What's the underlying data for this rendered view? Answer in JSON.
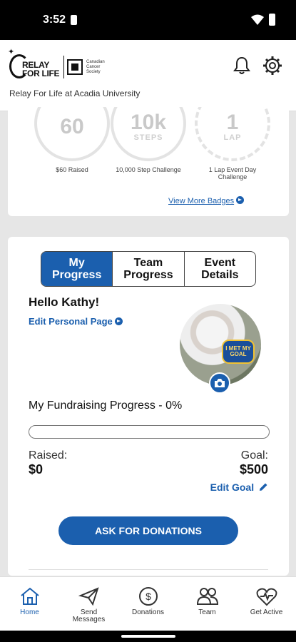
{
  "status_bar": {
    "time": "3:52"
  },
  "header": {
    "logo_text_top": "RELAY",
    "logo_text_bottom": "FOR LIFE",
    "partner_text": "Canadian Cancer Society",
    "subtitle": "Relay For Life at Acadia University"
  },
  "badges": {
    "items": [
      {
        "value": "60",
        "unit": "",
        "label": "$60 Raised"
      },
      {
        "value": "10k",
        "unit": "STEPS",
        "label": "10,000 Step Challenge"
      },
      {
        "value": "1",
        "unit": "LAP",
        "label": "1 Lap Event Day Challenge"
      }
    ],
    "view_more": "View More Badges"
  },
  "progress": {
    "tabs": [
      {
        "label": "My\nProgress",
        "active": true
      },
      {
        "label": "Team\nProgress",
        "active": false
      },
      {
        "label": "Event\nDetails",
        "active": false
      }
    ],
    "greeting": "Hello Kathy!",
    "edit_personal_page": "Edit Personal Page",
    "goal_badge_text": "I MET MY GOAL",
    "fundraising_title": "My Fundraising Progress - 0%",
    "percent": 0,
    "raised_label": "Raised:",
    "raised_value": "$0",
    "goal_label": "Goal:",
    "goal_value": "$500",
    "edit_goal": "Edit Goal",
    "ask_button": "ASK FOR DONATIONS"
  },
  "nav": {
    "items": [
      {
        "label": "Home",
        "icon": "home-icon",
        "active": true
      },
      {
        "label": "Send\nMessages",
        "icon": "send-icon",
        "active": false
      },
      {
        "label": "Donations",
        "icon": "dollar-icon",
        "active": false
      },
      {
        "label": "Team",
        "icon": "team-icon",
        "active": false
      },
      {
        "label": "Get Active",
        "icon": "heartbeat-icon",
        "active": false
      }
    ]
  },
  "colors": {
    "accent": "#1b5fae"
  }
}
